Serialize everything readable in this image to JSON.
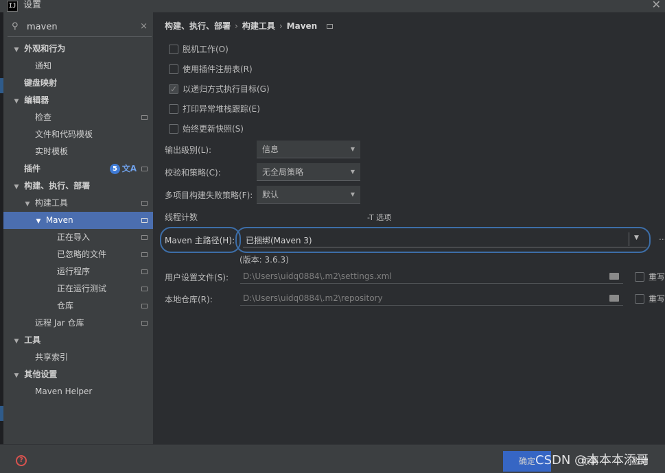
{
  "window": {
    "title": "设置",
    "app_icon": "IJ"
  },
  "search": {
    "value": "maven",
    "icon": "search-icon",
    "clear": "×"
  },
  "sidebar": {
    "items": [
      {
        "label": "外观和行为",
        "arrow": "v"
      },
      {
        "label": "通知"
      },
      {
        "label": "键盘映射"
      },
      {
        "label": "编辑器",
        "arrow": "v"
      },
      {
        "label": "检查"
      },
      {
        "label": "文件和代码模板"
      },
      {
        "label": "实时模板"
      },
      {
        "label": "插件",
        "badge": "5"
      },
      {
        "label": "构建、执行、部署",
        "arrow": "v"
      },
      {
        "label": "构建工具",
        "arrow": "v"
      },
      {
        "label": "Maven",
        "arrow": "v"
      },
      {
        "label": "正在导入"
      },
      {
        "label": "已忽略的文件"
      },
      {
        "label": "运行程序"
      },
      {
        "label": "正在运行测试"
      },
      {
        "label": "仓库"
      },
      {
        "label": "远程 Jar 仓库"
      },
      {
        "label": "工具",
        "arrow": "v"
      },
      {
        "label": "共享索引"
      },
      {
        "label": "其他设置",
        "arrow": "v"
      },
      {
        "label": "Maven Helper"
      }
    ]
  },
  "breadcrumb": {
    "part1": "构建、执行、部署",
    "sep": "›",
    "part2": "构建工具",
    "part3": "Maven"
  },
  "options": {
    "offline": "脱机工作(O)",
    "plugin_registry": "使用插件注册表(R)",
    "recursive": "以递归方式执行目标(G)",
    "print_stack": "打印异常堆栈跟踪(E)",
    "always_update": "始终更新快照(S)"
  },
  "fields": {
    "output_level_label": "输出级别(L):",
    "output_level_value": "信息",
    "checksum_label": "校验和策略(C):",
    "checksum_value": "无全局策略",
    "multiproject_label": "多项目构建失败策略(F):",
    "multiproject_value": "默认",
    "thread_label": "线程计数",
    "thread_hint": "-T 选项",
    "maven_home_label": "Maven 主路径(H):",
    "maven_home_value": "已捆绑(Maven 3)",
    "dots": "...",
    "version": "(版本: 3.6.3)",
    "user_settings_label": "用户设置文件(S):",
    "user_settings_value": "D:\\Users\\uidq0884\\.m2\\settings.xml",
    "local_repo_label": "本地仓库(R):",
    "local_repo_value": "D:\\Users\\uidq0884\\.m2\\repository",
    "override": "重写"
  },
  "footer": {
    "ok": "确定",
    "cancel": "取消",
    "apply": "应用",
    "watermark": "CSDN @本本本添哥"
  },
  "colors": {
    "accent": "#4b6eaf",
    "highlight_ring": "#3d6ea8",
    "badge": "#3f7bd6",
    "help": "#d9534f"
  }
}
